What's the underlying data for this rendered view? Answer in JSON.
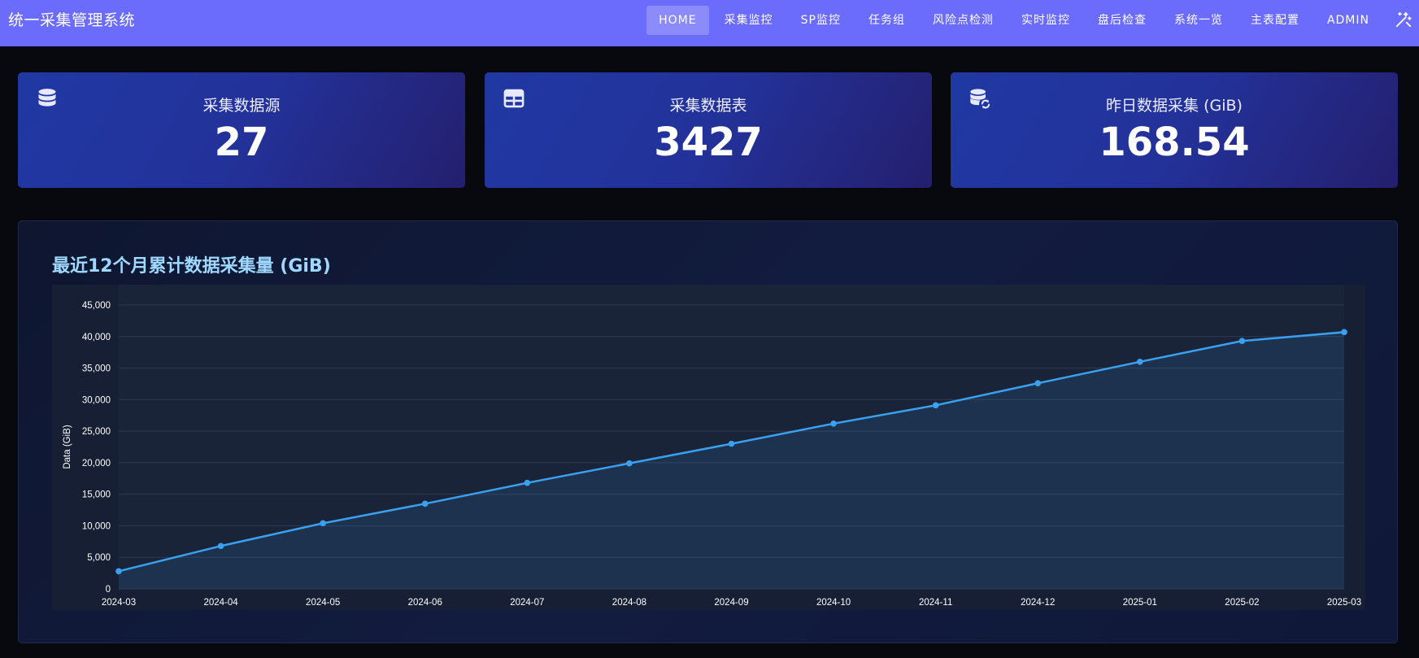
{
  "app": {
    "title": "统一采集管理系统"
  },
  "nav": {
    "items": [
      {
        "label": "HOME",
        "active": true
      },
      {
        "label": "采集监控",
        "active": false
      },
      {
        "label": "SP监控",
        "active": false
      },
      {
        "label": "任务组",
        "active": false
      },
      {
        "label": "风险点检测",
        "active": false
      },
      {
        "label": "实时监控",
        "active": false
      },
      {
        "label": "盘后检查",
        "active": false
      },
      {
        "label": "系统一览",
        "active": false
      },
      {
        "label": "主表配置",
        "active": false
      },
      {
        "label": "ADMIN",
        "active": false
      }
    ],
    "tool_icon": "magic-wand-icon"
  },
  "stats": [
    {
      "title": "采集数据源",
      "value": "27",
      "icon": "database-icon"
    },
    {
      "title": "采集数据表",
      "value": "3427",
      "icon": "table-icon"
    },
    {
      "title": "昨日数据采集 (GiB)",
      "value": "168.54",
      "icon": "database-sync-icon"
    }
  ],
  "chart": {
    "title": "最近12个月累计数据采集量 (GiB)"
  },
  "colors": {
    "nav_bg": "#6b6bfc",
    "line": "#3aa0f0",
    "title": "#9fd8ff"
  },
  "chart_data": {
    "type": "line",
    "ylabel": "Data (GiB)",
    "xlabel": "",
    "x": [
      "2024-03",
      "2024-04",
      "2024-05",
      "2024-06",
      "2024-07",
      "2024-08",
      "2024-09",
      "2024-10",
      "2024-11",
      "2024-12",
      "2025-01",
      "2025-02",
      "2025-03"
    ],
    "series": [
      {
        "values": [
          2800,
          6800,
          10400,
          13500,
          16800,
          19900,
          23000,
          26200,
          29100,
          32600,
          36000,
          39300,
          40700
        ]
      }
    ],
    "ylim": [
      0,
      45000
    ],
    "yticks": [
      0,
      5000,
      10000,
      15000,
      20000,
      25000,
      30000,
      35000,
      40000,
      45000
    ],
    "grid": true,
    "fill": true
  }
}
